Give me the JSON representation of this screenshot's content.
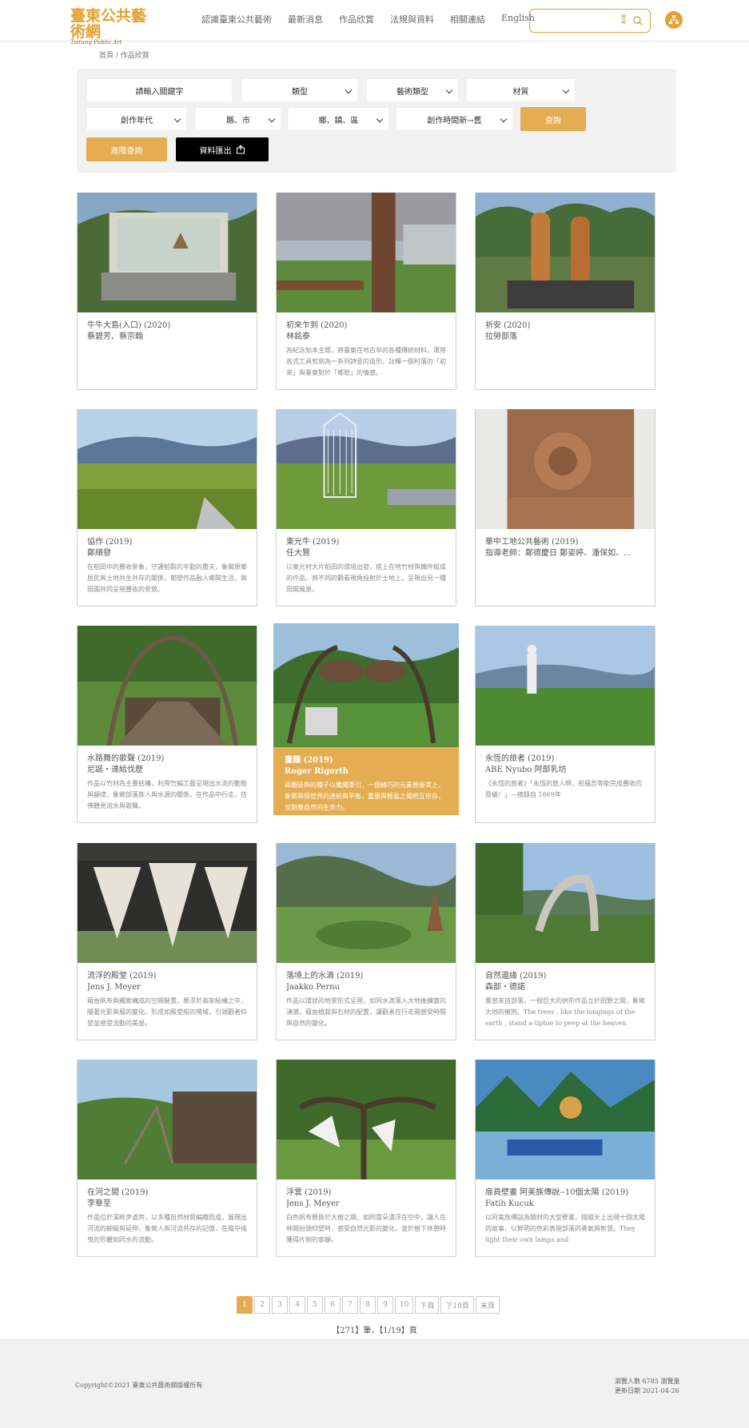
{
  "header": {
    "logo_text": "臺東公共藝術網",
    "logo_sub": "Taitung Public Art",
    "nav": [
      "認識臺東公共藝術",
      "最新消息",
      "作品欣賞",
      "法規與資料",
      "相關連結",
      "English"
    ],
    "search_placeholder": "",
    "search_label": "搜尋"
  },
  "breadcrumb": "首頁 / 作品欣賞",
  "filters": {
    "keyword_placeholder": "請輸入關鍵字",
    "type": "類型",
    "art_type": "藝術類型",
    "material": "材質",
    "year": "創作年代",
    "county": "縣、市",
    "town": "鄉、鎮、區",
    "order": "創作時間新→舊",
    "search_button": "查詢",
    "advanced_button": "進階查詢",
    "export_button": "資料匯出"
  },
  "artworks": [
    {
      "title": "牛牛大島(入口) (2020)",
      "artist": "蔡碧芳、蔡宗翰",
      "desc": ""
    },
    {
      "title": "初來乍到 (2020)",
      "artist": "林銘泰",
      "desc": "為紀念知本主題，將臺東在地古早的各種傳統材料，運用各式工具剪刻為一系列詩意的造形，詮釋一個村落的「初來」與臺東對於「鄉愁」的情感。"
    },
    {
      "title": "祈安 (2020)",
      "artist": "拉勞部落",
      "desc": ""
    },
    {
      "title": "協作 (2019)",
      "artist": "鄭順發",
      "desc": "在稻田中的豐收景象，守護稻穀的辛勤的農夫，象徵原鄉居民與土地共生共存的關係，期望作品融入鄉間生活，與田園共同呈現豐收的景致。"
    },
    {
      "title": "東光牛 (2019)",
      "artist": "任大賢",
      "desc": "以東光村大片稻田的環境出發，搭上在地竹材與鐵件組成的作品，將不同的觀看視角投射於土地上，呈現出另一種田間風景。"
    },
    {
      "title": "華中工地公共藝術 (2019)",
      "artist": "指導老師：鄭德慶日 鄭姿婷、潘保如、...",
      "desc": ""
    },
    {
      "title": "水路舞的歌聲 (2019)",
      "artist": "尼誕‧達給伐歷",
      "desc": "作品以竹材為主要結構，利用竹編工藝呈現出水流的動態與韻律，象徵部落族人與水源的關係，在作品中行走，彷彿聽見流水與歌聲。"
    },
    {
      "title": "重麵 (2019)",
      "artist": "Roger Rigorth",
      "desc": "兩顆延伸的種子以纖繩牽引，一個精巧的元素懸掛其上，象徵兩個世界的連結與平衡，重量與輕盈之間相互依存，並對應自然的生命力。"
    },
    {
      "title": "永恆的旅者 (2019)",
      "artist": "ABE Nyubo 阿部乳坊",
      "desc": "《永恆的旅者》「永恆的旅人啊，祝福吾等能完成豐收的祭儀！」—摘錄自 1869年"
    },
    {
      "title": "流浮的殿堂 (2019)",
      "artist": "Jens J. Meyer",
      "desc": "藉由帆布與繩索構成的空間裝置，懸浮於高架結構之中，隨著光影與風的變化，形成如殿堂般的場域，引領觀者仰望並感受流動的美感。"
    },
    {
      "title": "落境上的水滴 (2019)",
      "artist": "Jaakko Pernu",
      "desc": "作品以環狀的地景形式呈現，如同水滴落入大地後擴散的漣漪，藉由植栽與石材的配置，讓觀者在行走間感受時間與自然的變化。"
    },
    {
      "title": "自然邊緣 (2019)",
      "artist": "森部‧德諾",
      "desc": "靈感來自部落，一個巨大的拱形作品立於田野之間，象徵大地的擁抱。The trees , like the longings of the earth , stand a-tiptoe to peep at the heaven."
    },
    {
      "title": "在河之間 (2019)",
      "artist": "李章至",
      "desc": "作品位於溪畔步道旁，以多種自然材質編織而成，展現出河流的蜿蜒與延伸，象徵人與河流共存的記憶，在風中搖曳的形體如同水的流動。"
    },
    {
      "title": "浮雲 (2019)",
      "artist": "Jens J. Meyer",
      "desc": "白色帆布懸掛於大樹之間，如同雲朵漂浮在空中，讓人在林間抬頭仰望時，感受自然光影的變化，並於樹下休憩時獲得片刻的寧靜。"
    },
    {
      "title": "扉頁壁畫 阿美族傳說--10個太陽 (2019)",
      "artist": "Fatih Kucuk",
      "desc": "以阿美族傳說為題材的大型壁畫，描繪天上出現十個太陽的故事，以鮮明的色彩表現部落的勇氣與智慧。They light their own lamps and"
    }
  ],
  "pagination": {
    "pages": [
      "1",
      "2",
      "3",
      "4",
      "5",
      "6",
      "7",
      "8",
      "9",
      "10"
    ],
    "current": "1",
    "next": "下頁",
    "next10": "下10頁",
    "last": "末頁",
    "count_text": "【271】筆，【1/19】頁"
  },
  "footer": {
    "copyright": "Copyright©2021 臺東公共藝術網版權所有",
    "visits": "瀏覽人數 6785 瀏覽量",
    "updated": "更新日期 2021-04-26"
  },
  "colors": {
    "accent": "#e4ad51",
    "brand": "#e3a233",
    "panel": "#f1f1f1"
  }
}
